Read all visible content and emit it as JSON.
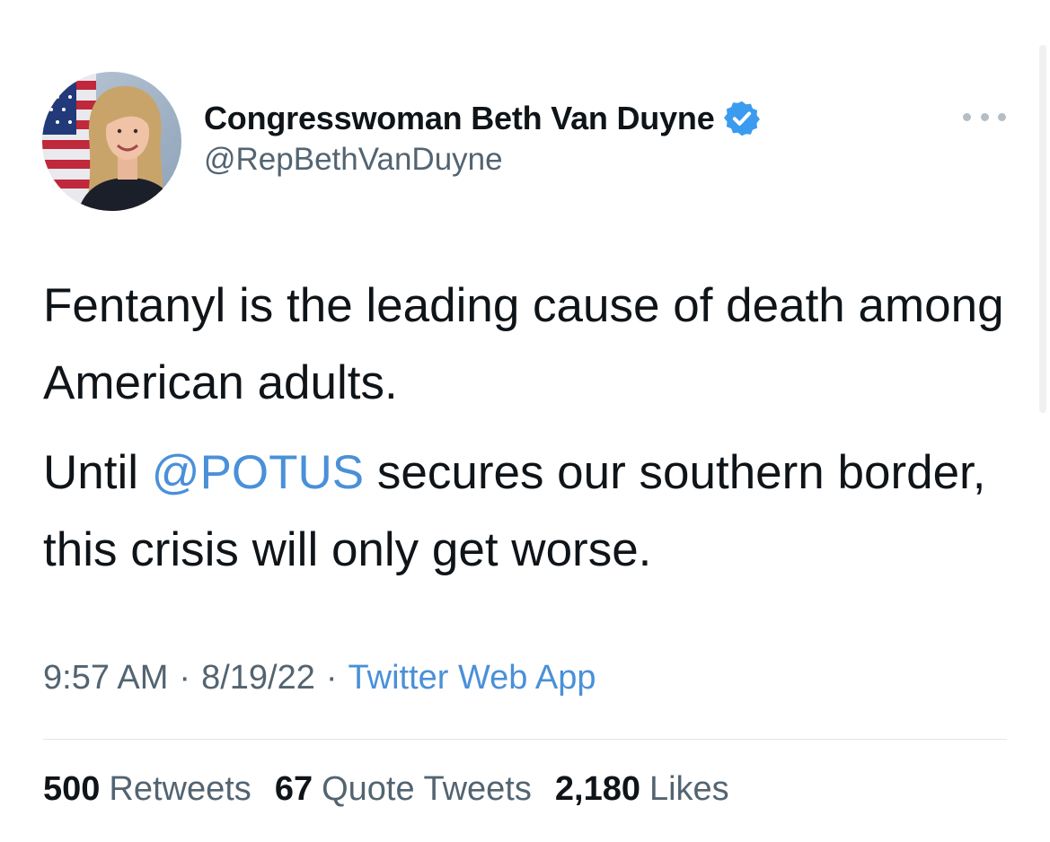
{
  "author": {
    "display_name": "Congresswoman Beth Van Duyne",
    "handle": "@RepBethVanDuyne",
    "verified_icon": "verified-badge-icon",
    "avatar_icon": "profile-photo"
  },
  "tweet": {
    "paragraph1": "Fentanyl is the leading cause of death among American adults.",
    "paragraph2_before": "Until ",
    "paragraph2_mention": "@POTUS",
    "paragraph2_after": " secures our southern border, this crisis will only get worse."
  },
  "meta": {
    "time": "9:57 AM",
    "separator": "·",
    "date": "8/19/22",
    "source": "Twitter Web App"
  },
  "stats": {
    "retweets_count": "500",
    "retweets_label": "Retweets",
    "quotes_count": "67",
    "quotes_label": "Quote Tweets",
    "likes_count": "2,180",
    "likes_label": "Likes"
  },
  "colors": {
    "link": "#4a90d9",
    "verified": "#3b9bef",
    "secondary_text": "#536471"
  }
}
